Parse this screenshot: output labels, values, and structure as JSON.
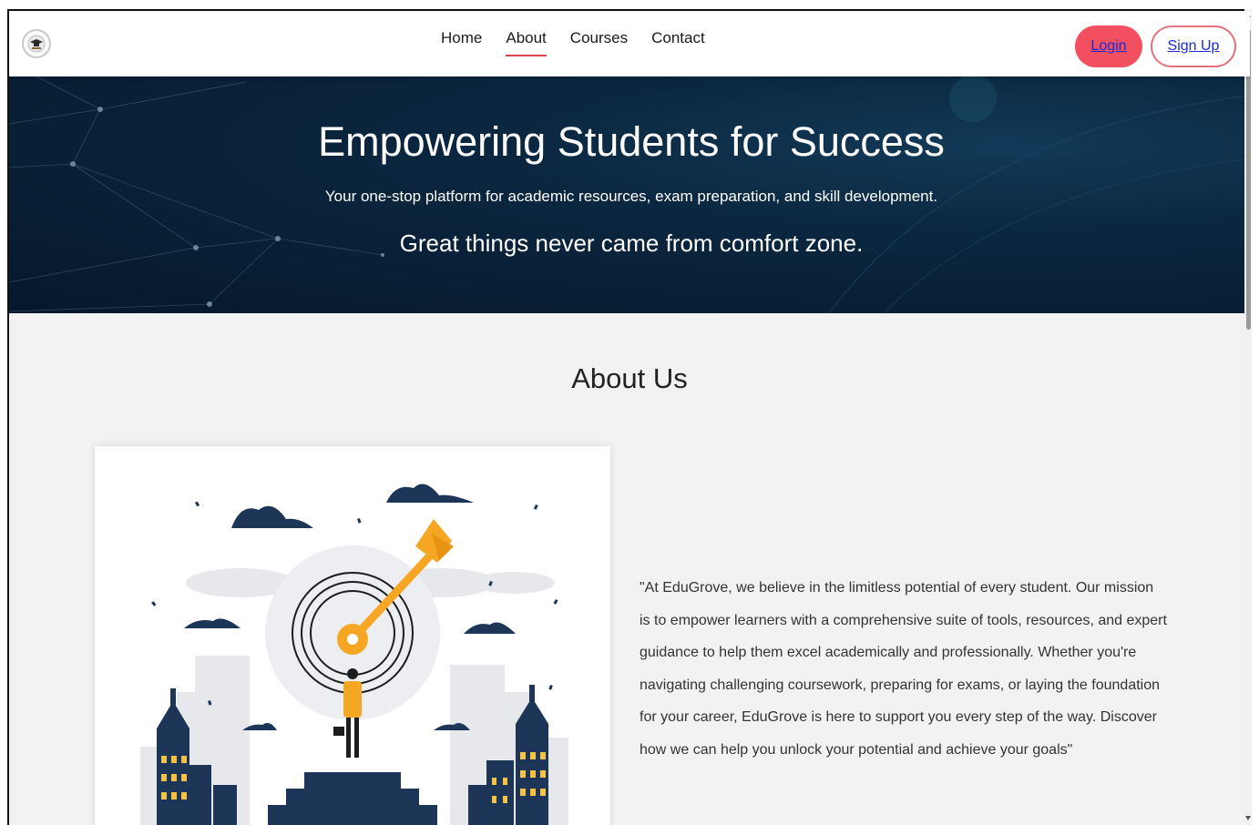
{
  "navbar": {
    "logo_icon": "graduation-cap-icon",
    "links": [
      {
        "label": "Home",
        "active": false
      },
      {
        "label": "About",
        "active": true
      },
      {
        "label": "Courses",
        "active": false
      },
      {
        "label": "Contact",
        "active": false
      }
    ],
    "login_label": "Login",
    "signup_label": "Sign Up"
  },
  "hero": {
    "title": "Empowering Students for Success",
    "subtitle": "Your one-stop platform for academic resources, exam preparation, and skill development.",
    "tagline": "Great things never came from comfort zone."
  },
  "about": {
    "heading": "About Us",
    "illustration": "target-goal-illustration",
    "body": "\"At EduGrove, we believe in the limitless potential of every student. Our mission is to empower learners with a comprehensive suite of tools, resources, and expert guidance to help them excel academically and professionally. Whether you're navigating challenging coursework, preparing for exams, or laying the foundation for your career, EduGrove is here to support you every step of the way. Discover how we can help you unlock your potential and achieve your goals\""
  },
  "colors": {
    "accent": "#f25060",
    "link": "#1a2bd8",
    "hero_bg": "#0b2740",
    "illustration_navy": "#1d3557",
    "illustration_orange": "#f5a623"
  }
}
